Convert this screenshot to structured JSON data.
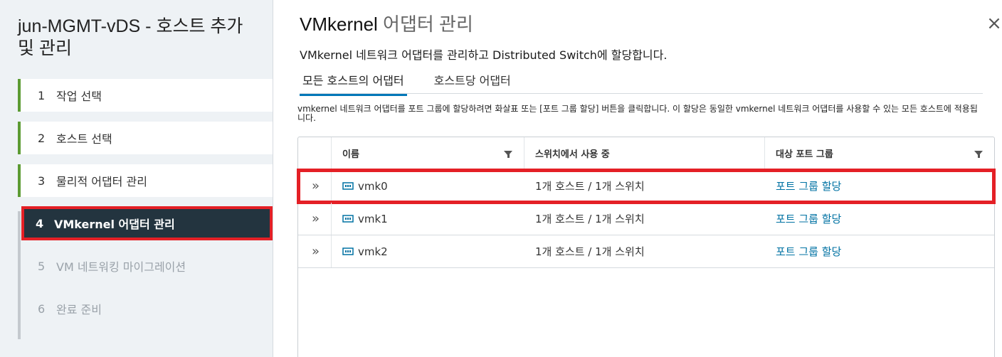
{
  "nav": {
    "title": "jun-MGMT-vDS - 호스트 추가 및 관리",
    "steps": [
      {
        "num": "1",
        "label": "작업 선택"
      },
      {
        "num": "2",
        "label": "호스트 선택"
      },
      {
        "num": "3",
        "label": "물리적 어댑터 관리"
      },
      {
        "num": "4",
        "label": "VMkernel 어댑터 관리"
      },
      {
        "num": "5",
        "label": "VM 네트워킹 마이그레이션"
      },
      {
        "num": "6",
        "label": "완료 준비"
      }
    ]
  },
  "main": {
    "title_main": "VMkernel",
    "title_sub": " 어댑터 관리",
    "close_glyph": "×",
    "subtitle": "VMkernel 네트워크 어댑터를 관리하고 Distributed Switch에 할당합니다.",
    "tabs": [
      "모든 호스트의 어댑터",
      "호스트당 어댑터"
    ],
    "instructions": "vmkernel 네트워크 어댑터를 포트 그룹에 할당하려면 화살표 또는 [포트 그룹 할당] 버튼을 클릭합니다. 이 할당은 동일한 vmkernel 네트워크 어댑터를 사용할 수 있는 모든 호스트에 적용됩니다."
  },
  "grid": {
    "columns": [
      "이름",
      "스위치에서 사용 중",
      "대상 포트 그룹"
    ],
    "rows": [
      {
        "expand": "»",
        "name": "vmk0",
        "in_use": "1개 호스트 / 1개 스위치",
        "action": "포트 그룹 할당"
      },
      {
        "expand": "»",
        "name": "vmk1",
        "in_use": "1개 호스트 / 1개 스위치",
        "action": "포트 그룹 할당"
      },
      {
        "expand": "»",
        "name": "vmk2",
        "in_use": "1개 호스트 / 1개 스위치",
        "action": "포트 그룹 할당"
      }
    ]
  },
  "colors": {
    "accent": "#0077b8",
    "active_step": "#23343f",
    "completed_bar": "#5c9b33",
    "highlight": "#e42026",
    "link": "#0072a3"
  },
  "icons": {
    "close": "close-icon",
    "expand": "expand-icon",
    "nic": "network-adapter-icon",
    "filter": "filter-icon"
  }
}
